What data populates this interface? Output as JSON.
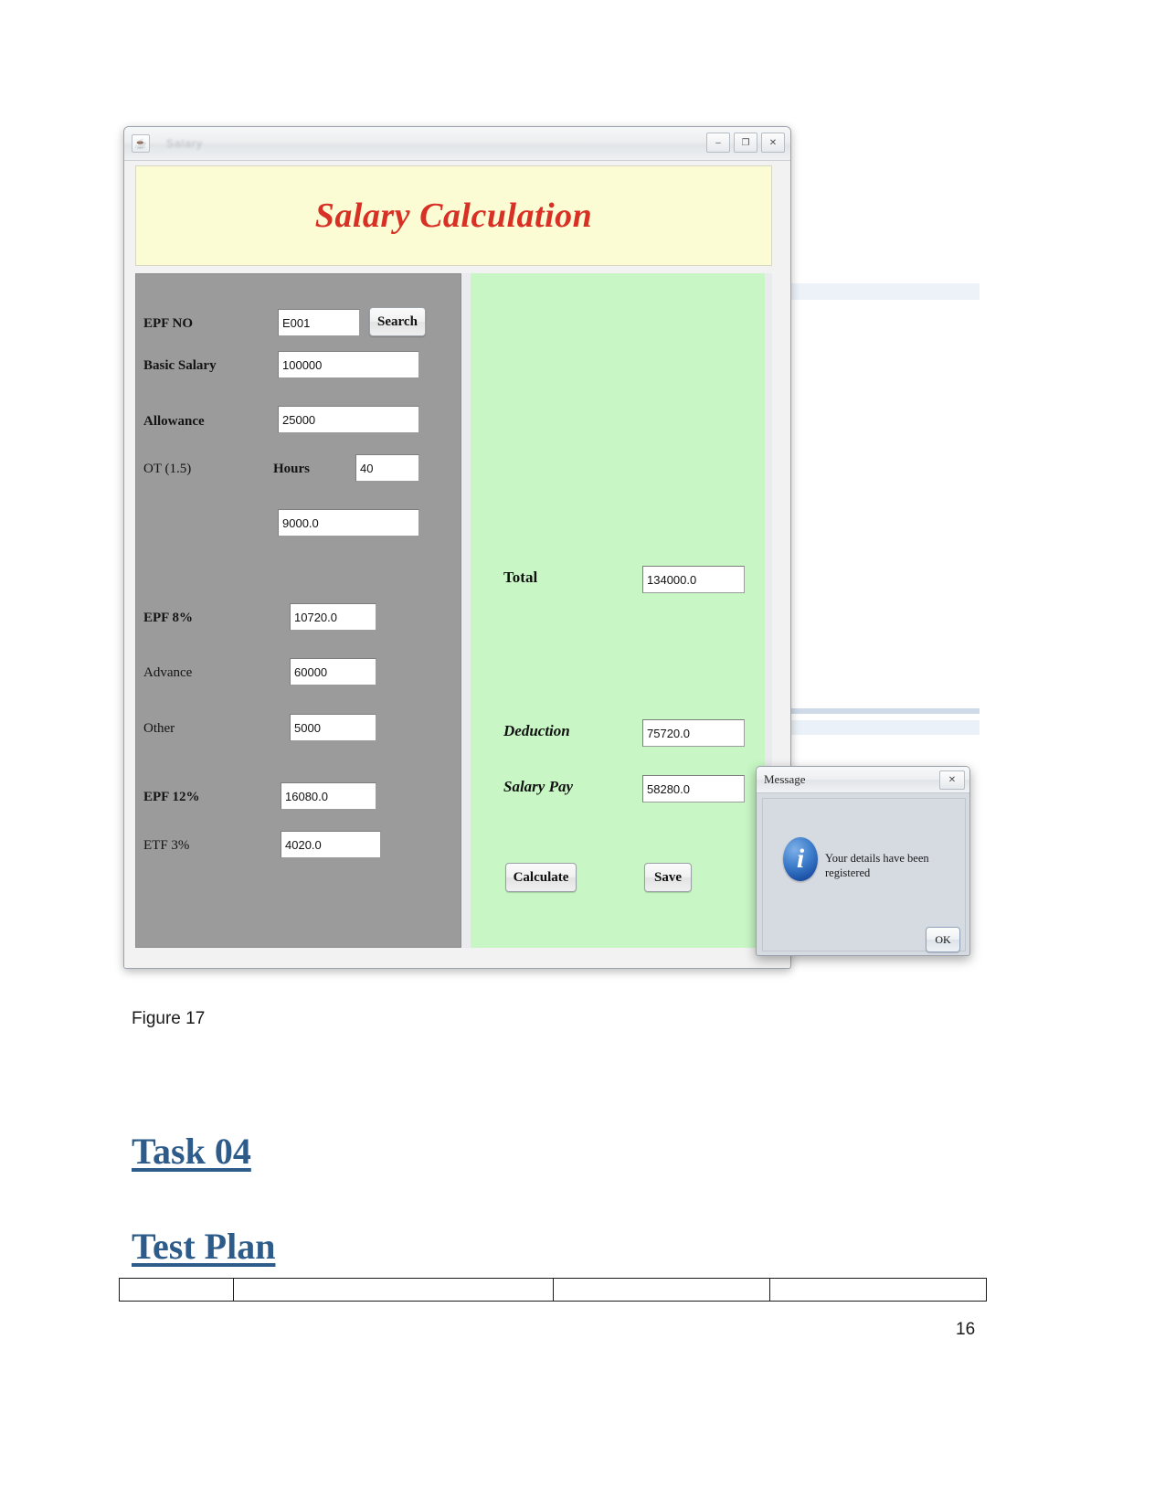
{
  "window": {
    "title_blurred": "Salary",
    "app_icon": "java-cup-icon",
    "minimize_label": "–",
    "maximize_label": "❐",
    "close_label": "✕",
    "banner_title": "Salary Calculation"
  },
  "form": {
    "epf_no_label": "EPF NO",
    "epf_no_value": "E001",
    "search_button": "Search",
    "basic_salary_label": "Basic Salary",
    "basic_salary_value": "100000",
    "allowance_label": "Allowance",
    "allowance_value": "25000",
    "ot_label": "OT (1.5)",
    "hours_label": "Hours",
    "hours_value": "40",
    "ot_amount_value": "9000.0",
    "epf8_label": "EPF 8%",
    "epf8_value": "10720.0",
    "advance_label": "Advance",
    "advance_value": "60000",
    "other_label": "Other",
    "other_value": "5000",
    "epf12_label": "EPF 12%",
    "epf12_value": "16080.0",
    "etf3_label": "ETF 3%",
    "etf3_value": "4020.0"
  },
  "results": {
    "total_label": "Total",
    "total_value": "134000.0",
    "deduction_label": "Deduction",
    "deduction_value": "75720.0",
    "salary_pay_label": "Salary Pay",
    "salary_pay_value": "58280.0",
    "calculate_button": "Calculate",
    "save_button": "Save"
  },
  "dialog": {
    "title": "Message",
    "close_label": "✕",
    "icon": "info-icon",
    "icon_glyph": "i",
    "message": "Your details have been registered",
    "ok_button": "OK"
  },
  "document": {
    "figure_caption": "Figure 17",
    "heading_task": "Task 04",
    "heading_test_plan": "Test Plan",
    "page_number": "16"
  },
  "colors": {
    "banner_bg": "#fbfbd4",
    "banner_text": "#d93025",
    "left_panel_bg": "#9b9b9b",
    "right_panel_bg": "#c8f7c5",
    "heading_blue": "#2e5c8a",
    "info_icon_blue": "#1c52a8"
  }
}
